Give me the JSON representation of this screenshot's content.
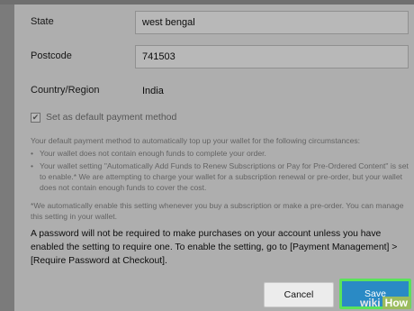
{
  "form": {
    "state": {
      "label": "State",
      "value": "west bengal"
    },
    "postcode": {
      "label": "Postcode",
      "value": "741503"
    },
    "country": {
      "label": "Country/Region",
      "value": "India"
    }
  },
  "default_payment": {
    "label": "Set as default payment method",
    "checked": true
  },
  "info": {
    "intro": "Your default payment method to automatically top up your wallet for the following circumstances:",
    "bullet1": "Your wallet does not contain enough funds to complete your order.",
    "bullet2": "Your wallet setting \"Automatically Add Funds to Renew Subscriptions or Pay for Pre-Ordered Content\" is set to enable.* We are attempting to charge your wallet for a subscription renewal or pre-order, but your wallet does not contain enough funds to cover the cost.",
    "footnote": "*We automatically enable this setting whenever you buy a subscription or make a pre-order. You can manage this setting in your wallet."
  },
  "notice": "A password will not be required to make purchases on your account unless you have enabled the setting to require one. To enable the setting, go to [Payment Management] > [Require Password at Checkout].",
  "buttons": {
    "cancel": "Cancel",
    "save": "Save"
  },
  "watermark": {
    "part1": "wiki",
    "part2": "How"
  }
}
